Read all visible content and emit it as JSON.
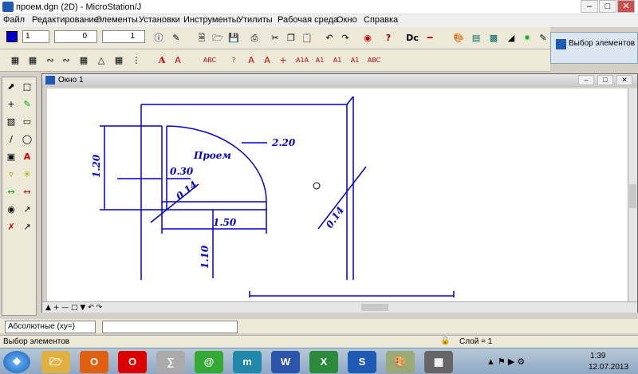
{
  "window": {
    "title": "проем.dgn (2D) - MicroStation/J"
  },
  "menu": [
    "Файл",
    "Редактирование",
    "Элементы",
    "Установки",
    "Инструменты",
    "Утилиты",
    "Рабочая среда",
    "Окно",
    "Справка"
  ],
  "toolbar": {
    "color": "1",
    "line_style": "0",
    "line_weight": "1"
  },
  "tool_settings": {
    "title": "Выбор элементов"
  },
  "view": {
    "title": "Окно 1"
  },
  "drawing": {
    "dims": [
      "2.20",
      "1.20",
      "0.30",
      "0.14",
      "Проем",
      "1.50",
      "1.10",
      "0.14"
    ]
  },
  "coords": {
    "mode": "Абсолютные (xy=)",
    "value": ""
  },
  "status": {
    "message": "Выбор элементов",
    "layer": "Слой = 1"
  },
  "clock": {
    "time": "1:39",
    "date": "12.07.2013"
  },
  "icons": [
    "microstation-icon",
    "minimize-icon",
    "maximize-icon",
    "close-icon",
    "new-icon",
    "open-icon",
    "save-icon",
    "print-icon",
    "cut-icon",
    "copy-icon",
    "paste-icon",
    "undo-icon",
    "redo-icon",
    "help-icon",
    "text-icon",
    "select-arrow-icon",
    "windows-start-icon"
  ]
}
